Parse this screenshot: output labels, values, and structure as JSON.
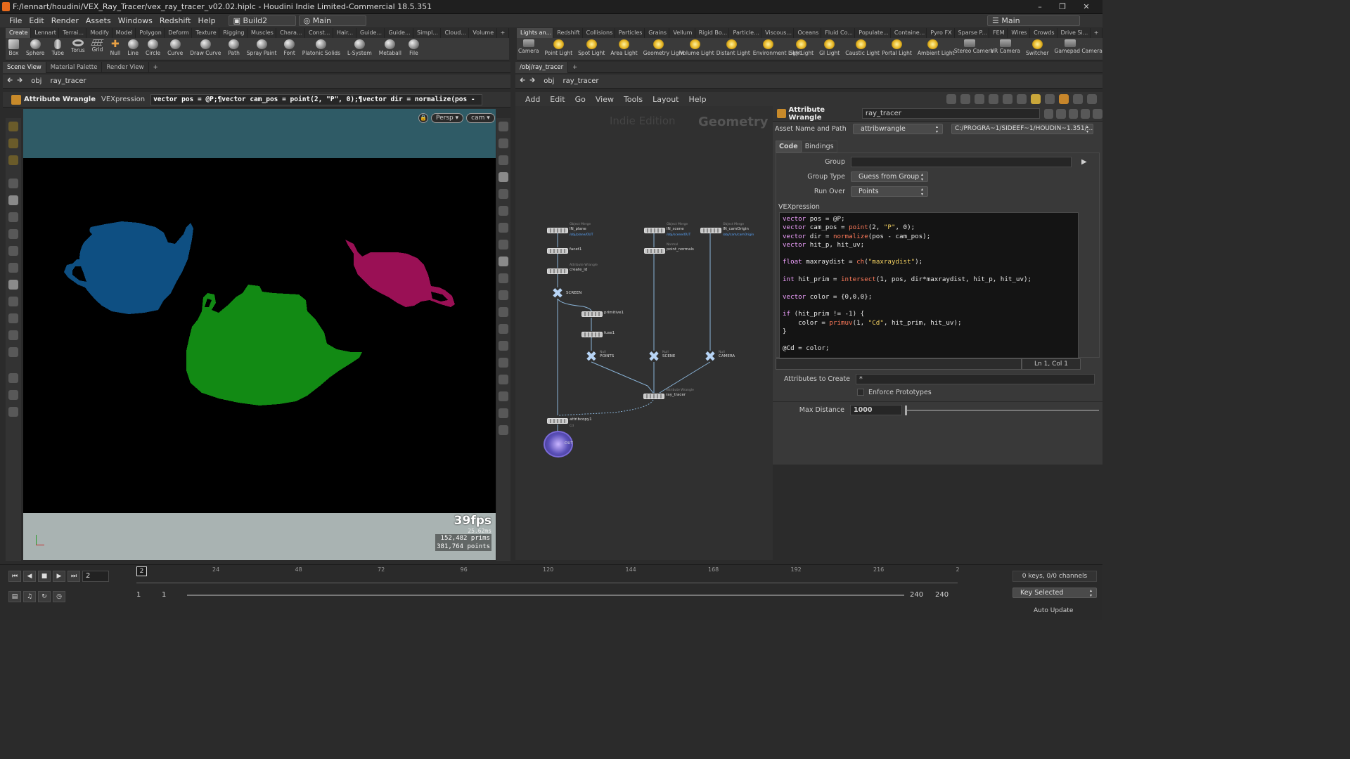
{
  "window": {
    "title": "F:/lennart/houdini/VEX_Ray_Tracer/vex_ray_tracer_v02.02.hiplc - Houdini Indie Limited-Commercial 18.5.351"
  },
  "menubar": {
    "items": [
      "File",
      "Edit",
      "Render",
      "Assets",
      "Windows",
      "Redshift",
      "Help"
    ],
    "desktop": "Build2",
    "context": "Main",
    "right_desktop": "Main"
  },
  "left_shelf": {
    "tabs": [
      "Create",
      "Lennart",
      "Terrai...",
      "Modify",
      "Model",
      "Polygon",
      "Deform",
      "Texture",
      "Rigging",
      "Muscles",
      "Chara...",
      "Const...",
      "Hair...",
      "Guide...",
      "Guide...",
      "Simpl...",
      "Cloud...",
      "Volume"
    ],
    "tools": [
      {
        "label": "Box",
        "icon": "box-icon"
      },
      {
        "label": "Sphere",
        "icon": "sphere-icon"
      },
      {
        "label": "Tube",
        "icon": "tube-icon"
      },
      {
        "label": "Torus",
        "icon": "torus-icon"
      },
      {
        "label": "Grid",
        "icon": "grid-icon"
      },
      {
        "label": "Null",
        "icon": "null-icon"
      },
      {
        "label": "Line",
        "icon": "line-icon"
      },
      {
        "label": "Circle",
        "icon": "circle-icon"
      },
      {
        "label": "Curve",
        "icon": "curve-icon"
      },
      {
        "label": "Draw Curve",
        "icon": "draw-curve-icon"
      },
      {
        "label": "Path",
        "icon": "path-icon"
      },
      {
        "label": "Spray Paint",
        "icon": "spray-paint-icon"
      },
      {
        "label": "Font",
        "icon": "font-icon"
      },
      {
        "label": "Platonic Solids",
        "icon": "platonic-icon"
      },
      {
        "label": "L-System",
        "icon": "lsystem-icon"
      },
      {
        "label": "Metaball",
        "icon": "metaball-icon"
      },
      {
        "label": "File",
        "icon": "file-icon"
      }
    ]
  },
  "right_shelf": {
    "tabs": [
      "Lights an...",
      "Redshift",
      "Collisions",
      "Particles",
      "Grains",
      "Vellum",
      "Rigid Bo...",
      "Particle...",
      "Viscous...",
      "Oceans",
      "Fluid Co...",
      "Populate...",
      "Containe...",
      "Pyro FX",
      "Sparse P...",
      "FEM",
      "Wires",
      "Crowds",
      "Drive Si..."
    ],
    "tools": [
      {
        "label": "Camera",
        "icon": "camera-icon"
      },
      {
        "label": "Point Light",
        "icon": "point-light-icon"
      },
      {
        "label": "Spot Light",
        "icon": "spot-light-icon"
      },
      {
        "label": "Area Light",
        "icon": "area-light-icon"
      },
      {
        "label": "Geometry Light",
        "icon": "geometry-light-icon"
      },
      {
        "label": "Volume Light",
        "icon": "volume-light-icon"
      },
      {
        "label": "Distant Light",
        "icon": "distant-light-icon"
      },
      {
        "label": "Environment Light",
        "icon": "environment-light-icon"
      },
      {
        "label": "Sky Light",
        "icon": "sky-light-icon"
      },
      {
        "label": "GI Light",
        "icon": "gi-light-icon"
      },
      {
        "label": "Caustic Light",
        "icon": "caustic-light-icon"
      },
      {
        "label": "Portal Light",
        "icon": "portal-light-icon"
      },
      {
        "label": "Ambient Light",
        "icon": "ambient-light-icon"
      },
      {
        "label": "Stereo Camera",
        "icon": "stereo-camera-icon"
      },
      {
        "label": "VR Camera",
        "icon": "vr-camera-icon"
      },
      {
        "label": "Switcher",
        "icon": "switcher-icon"
      },
      {
        "label": "Gamepad Camera",
        "icon": "gamepad-camera-icon"
      }
    ]
  },
  "left_pane": {
    "tabs": [
      "Scene View",
      "Material Palette",
      "Render View"
    ],
    "path": [
      "obj",
      "ray_tracer"
    ],
    "operator": "Attribute Wrangle",
    "operator_name": "VEXpression",
    "snippet_preview": "vector pos = @P;¶vector cam_pos = point(2, \"P\", 0);¶vector dir = normalize(pos -",
    "view_mode": "Persp",
    "camera": "cam",
    "fps": "39fps",
    "ms": "25.62ms",
    "prims_count": "152,482",
    "prims_label": "prims",
    "points_count": "381,764",
    "points_label": "points",
    "background_color": "#000000",
    "teapot_colors": [
      "#0e4f82",
      "#128a14",
      "#9a1055"
    ]
  },
  "right_pane": {
    "tab": "/obj/ray_tracer",
    "path": [
      "obj",
      "ray_tracer"
    ],
    "menu": [
      "Add",
      "Edit",
      "Go",
      "View",
      "Tools",
      "Layout",
      "Help"
    ],
    "watermark_indie": "Indie Edition",
    "watermark_context": "Geometry"
  },
  "network": {
    "nodes": [
      {
        "id": "IN_plane",
        "label": "IN_plane",
        "sub": "Object Merge",
        "path": "/obj/plane/OUT"
      },
      {
        "id": "facet1",
        "label": "facet1"
      },
      {
        "id": "create_id",
        "label": "create_id",
        "sub": "Attribute Wrangle"
      },
      {
        "id": "SCREEN",
        "label": "SCREEN"
      },
      {
        "id": "primitive1",
        "label": "primitive1"
      },
      {
        "id": "fuse1",
        "label": "fuse1"
      },
      {
        "id": "POINTS",
        "label": "POINTS",
        "sub": "Null"
      },
      {
        "id": "IN_scene",
        "label": "IN_scene",
        "sub": "Object Merge",
        "path": "/obj/scene/OUT"
      },
      {
        "id": "point_normals",
        "label": "point_normals",
        "sub": "Normal"
      },
      {
        "id": "SCENE",
        "label": "SCENE",
        "sub": "Null"
      },
      {
        "id": "IN_camOrigin",
        "label": "IN_camOrigin",
        "sub": "Object Merge",
        "path": "/obj/cam/camOrigin"
      },
      {
        "id": "CAMERA",
        "label": "CAMERA",
        "sub": "Null"
      },
      {
        "id": "ray_tracer",
        "label": "ray_tracer",
        "sub": "Attribute Wrangle"
      },
      {
        "id": "attribcopy1",
        "label": "attribcopy1",
        "sub2": "Cd"
      },
      {
        "id": "OUT",
        "label": "OUT"
      }
    ]
  },
  "params": {
    "node_type": "Attribute Wrangle",
    "node_name": "ray_tracer",
    "asset_label": "Asset Name and Path",
    "asset_name": "attribwrangle",
    "asset_path": "C:/PROGRA~1/SIDEEF~1/HOUDIN~1.351/...",
    "tabs": [
      "Code",
      "Bindings"
    ],
    "group_label": "Group",
    "group_value": "",
    "group_type_label": "Group Type",
    "group_type_value": "Guess from Group",
    "run_over_label": "Run Over",
    "run_over_value": "Points",
    "vex_label": "VEXpression",
    "cursor_pos": "Ln 1, Col 1",
    "attrs_label": "Attributes to Create",
    "attrs_value": "*",
    "enforce_label": "Enforce Prototypes",
    "maxdist_label": "Max Distance",
    "maxdist_value": "1000"
  },
  "code_lines": [
    "vector pos = @P;",
    "vector cam_pos = point(2, \"P\", 0);",
    "vector dir = normalize(pos - cam_pos);",
    "vector hit_p, hit_uv;",
    "",
    "float maxraydist = ch(\"maxraydist\");",
    "",
    "int hit_prim = intersect(1, pos, dir*maxraydist, hit_p, hit_uv);",
    "",
    "vector color = {0,0,0};",
    "",
    "if (hit_prim != -1) {",
    "    color = primuv(1, \"Cd\", hit_prim, hit_uv);",
    "}",
    "",
    "@Cd = color;"
  ],
  "timeline": {
    "current_frame": "2",
    "marker_frame": "2",
    "ticks": [
      "24",
      "48",
      "72",
      "96",
      "120",
      "144",
      "168",
      "192",
      "216",
      "2"
    ],
    "range_start": "1",
    "range_start2": "1",
    "range_end": "240",
    "range_end2": "240",
    "keys_info": "0 keys, 0/0 channels",
    "key_mode": "Key Selected",
    "update_mode": "Auto Update"
  }
}
